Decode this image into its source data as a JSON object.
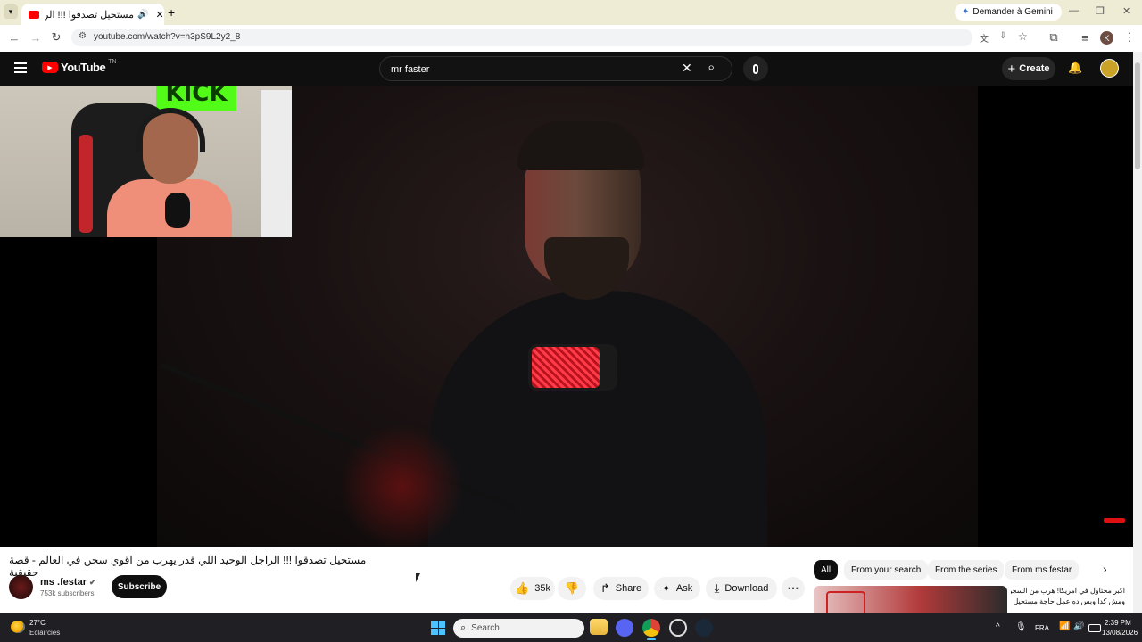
{
  "browser": {
    "tab_title": "مستحيل تصدقوا !!! الراجل ال",
    "gemini_button": "Demander à Gemini",
    "url": "youtube.com/watch?v=h3pS9L2y2_8",
    "profile_initial": "K"
  },
  "youtube": {
    "logo_text": "YouTube",
    "logo_country": "TN",
    "search_value": "mr faster",
    "create_label": "Create"
  },
  "video": {
    "title": "مستحيل تصدقوا !!! الراجل الوحيد اللي قدر يهرب من اقوي سجن في العالم - قصة حقيقية",
    "overlay_text": "KICK"
  },
  "channel": {
    "name": "ms .festar",
    "subscribers": "753k subscribers",
    "subscribe_label": "Subscribe"
  },
  "actions": {
    "likes": "35k",
    "share": "Share",
    "ask": "Ask",
    "download": "Download"
  },
  "chips": [
    "All",
    "From your search",
    "From the series",
    "From ms.festar"
  ],
  "recommendation": {
    "title_line1": "اكبر محتاول في امريكا! هرب من السجن",
    "title_line2": "ومش كدا وبس ده عمل حاجة مستحيل"
  },
  "taskbar": {
    "weather_temp": "27°C",
    "weather_desc": "Eclaircies",
    "search_placeholder": "Search",
    "language": "FRA",
    "time": "2:39 PM",
    "date": "13/08/2026"
  },
  "colors": {
    "youtube_red": "#ff0000",
    "header_bg": "#0f0f0f",
    "tabstrip_bg": "#efecd5",
    "taskbar_bg": "#1f1f24"
  }
}
